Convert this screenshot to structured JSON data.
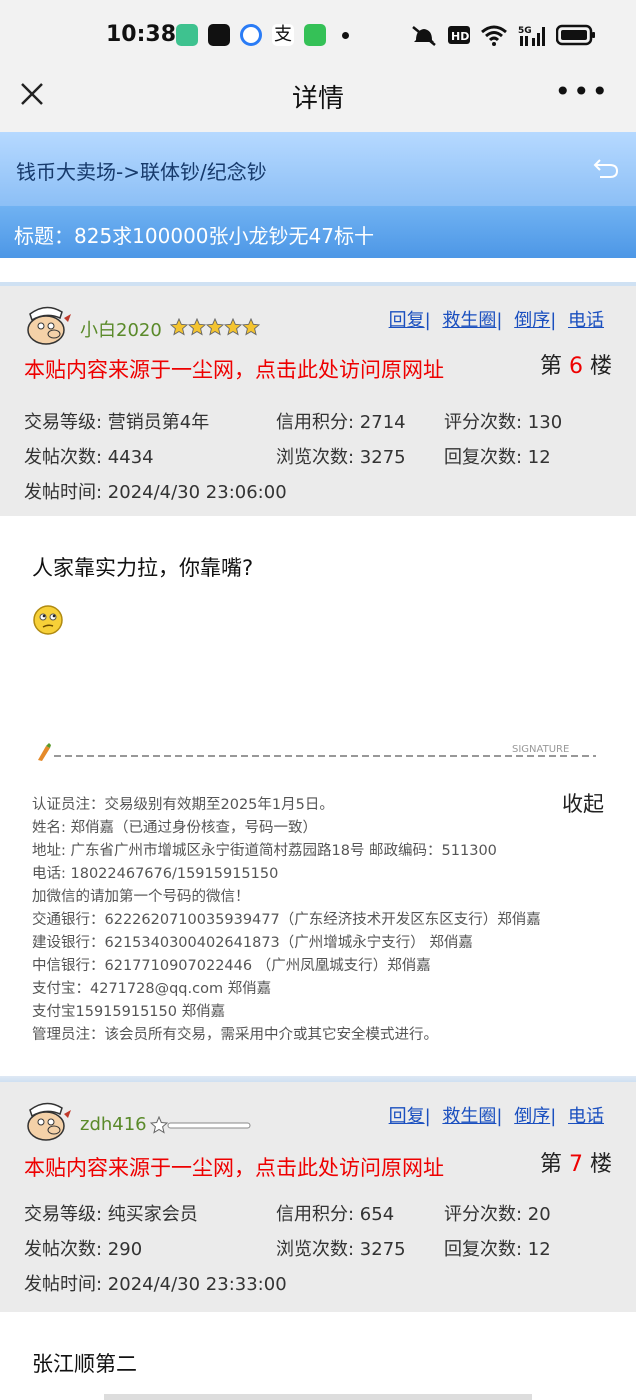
{
  "status": {
    "time": "10:38",
    "network": "5G"
  },
  "topbar": {
    "title": "详情",
    "more": "•••"
  },
  "breadcrumb": "钱币大卖场->联体钞/纪念钞",
  "thread_title": "标题：825求100000张小龙钞无47标十",
  "posts": [
    {
      "username": "小白2020",
      "links": [
        "回复",
        "救生圈",
        "倒序",
        "电话"
      ],
      "source": "本贴内容来源于一尘网，点击此处访问原网址",
      "floor_prefix": "第",
      "floor_num": "6",
      "floor_suffix": "楼",
      "level": "交易等级: 营销员第4年",
      "credit": "信用积分: 2714",
      "ratings": "评分次数: 130",
      "posts": "发帖次数: 4434",
      "views": "浏览次数: 3275",
      "replies": "回复次数: 12",
      "time": "发帖时间: 2024/4/30 23:06:00",
      "content": "人家靠实力拉，你靠嘴?",
      "collapse": "收起",
      "signature_label": "SIGNATURE",
      "signature": [
        "认证员注：交易级别有效期至2025年1月5日。",
        "姓名: 郑俏嘉（已通过身份核查，号码一致）",
        "地址: 广东省广州市增城区永宁街道简村荔园路18号   邮政编码：511300",
        "电话: 18022467676/15915915150",
        "加微信的请加第一个号码的微信！",
        "交通银行：6222620710035939477（广东经济技术开发区东区支行）郑俏嘉",
        "建设银行：6215340300402641873（广州增城永宁支行） 郑俏嘉",
        "中信银行：6217710907022446 （广州凤凰城支行）郑俏嘉",
        "支付宝：4271728@qq.com 郑俏嘉",
        "支付宝15915915150 郑俏嘉",
        "管理员注：该会员所有交易，需采用中介或其它安全模式进行。"
      ]
    },
    {
      "username": "zdh416",
      "links": [
        "回复",
        "救生圈",
        "倒序",
        "电话"
      ],
      "source": "本贴内容来源于一尘网，点击此处访问原网址",
      "floor_prefix": "第",
      "floor_num": "7",
      "floor_suffix": "楼",
      "level": "交易等级: 纯买家会员",
      "credit": "信用积分: 654",
      "ratings": "评分次数: 20",
      "posts": "发帖次数: 290",
      "views": "浏览次数: 3275",
      "replies": "回复次数: 12",
      "time": "发帖时间: 2024/4/30 23:33:00",
      "content": "张江顺第二"
    }
  ],
  "colors": {
    "accent_red": "#e00000",
    "link_blue": "#1a4fbf",
    "username_green": "#5a8a2a"
  }
}
